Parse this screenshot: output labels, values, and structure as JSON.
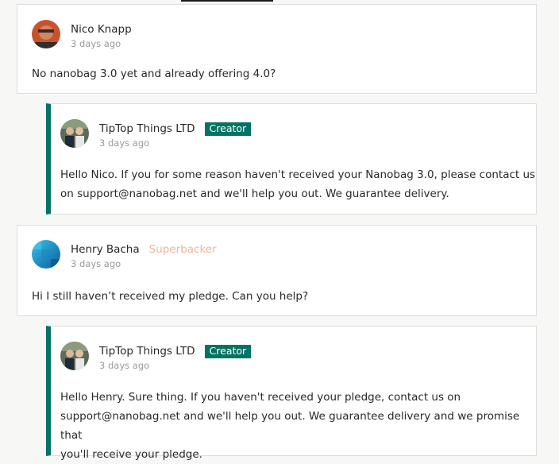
{
  "comments": [
    {
      "author": "Nico Knapp",
      "time": "3 days ago",
      "text": "No nanobag 3.0 yet and already offering 4.0?",
      "avatar_icon": "user-photo-icon"
    },
    {
      "author": "TipTop Things LTD",
      "badge": "Creator",
      "time": "3 days ago",
      "lines": [
        "Hello Nico. If you for some reason haven't received your Nanobag 3.0, please contact us",
        "on support@nanobag.net and we'll help you out. We guarantee delivery."
      ],
      "avatar_icon": "team-photo-icon"
    },
    {
      "author": "Henry Bacha",
      "badge": "Superbacker",
      "time": "3 days ago",
      "text": "Hi I still haven’t received my pledge. Can you help?",
      "avatar_icon": "blue-gradient-avatar-icon"
    },
    {
      "author": "TipTop Things LTD",
      "badge": "Creator",
      "time": "3 days ago",
      "lines": [
        "Hello Henry. Sure thing. If you haven't received your pledge, contact us on",
        "support@nanobag.net and we'll help you out. We guarantee delivery and we promise that",
        "you'll receive your pledge."
      ],
      "avatar_icon": "team-photo-icon"
    }
  ],
  "colors": {
    "creator_accent": "#037362",
    "superbacker": "#f0b49a",
    "muted": "#9a9a9a"
  }
}
